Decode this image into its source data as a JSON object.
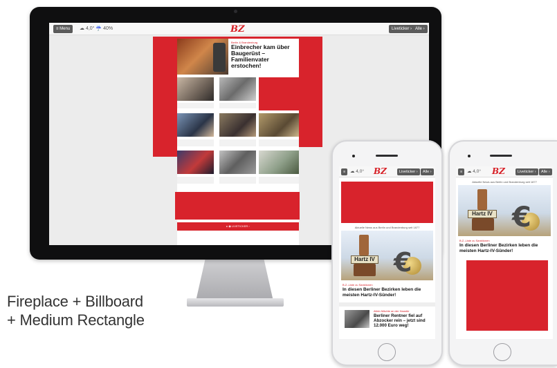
{
  "colors": {
    "brand_red": "#d71f26",
    "ad_red": "#d8232c",
    "bezel": "#0f0f10"
  },
  "caption": {
    "line1": "Fireplace + Billboard",
    "line2": "+ Medium Rectangle"
  },
  "desktop": {
    "menu_label": "≡ Menu",
    "weather": "☁ 4,0°  ☔ 40%",
    "logo": "BZ",
    "liveticker_label": "Liveticker ›",
    "alle_label": "Alle ›",
    "lead": {
      "kicker": "Berlin & Brandenburg",
      "title": "Einbrecher kam über Baugerüst – Familienvater erstochen!",
      "text": ""
    },
    "footer_label": "▸ ◉ LIVETICKER ›"
  },
  "phone1": {
    "menu_icon": "≡",
    "weather": "☁ 4,0°",
    "logo": "BZ",
    "liveticker_label": "Liveticker ›",
    "alle_label": "Alle ›",
    "banner": "Aktuelle News aus Berlin und Brandenburg seit 1877",
    "stamp_text": "Hartz IV",
    "article_kicker": "B.Z.-Liste zu Sanktionen",
    "article_title": "In diesen Berliner Bezirken leben die meisten Hartz-IV-Sünder!",
    "second_kicker": "Allein Mächte an der Haustür",
    "second_title": "Berliner Rentner fiel auf Abzocker rein – jetzt sind 12.000 Euro weg!"
  },
  "phone2": {
    "menu_icon": "≡",
    "weather": "☁ 4,0°",
    "logo": "BZ",
    "liveticker_label": "Liveticker ›",
    "alle_label": "Alle ›",
    "banner": "Aktuelle News aus Berlin und Brandenburg seit 1877",
    "stamp_text": "Hartz IV",
    "article_kicker": "B.Z.-Liste zu Sanktionen",
    "article_title": "In diesen Berliner Bezirken leben die meisten Hartz-IV-Sünder!"
  }
}
